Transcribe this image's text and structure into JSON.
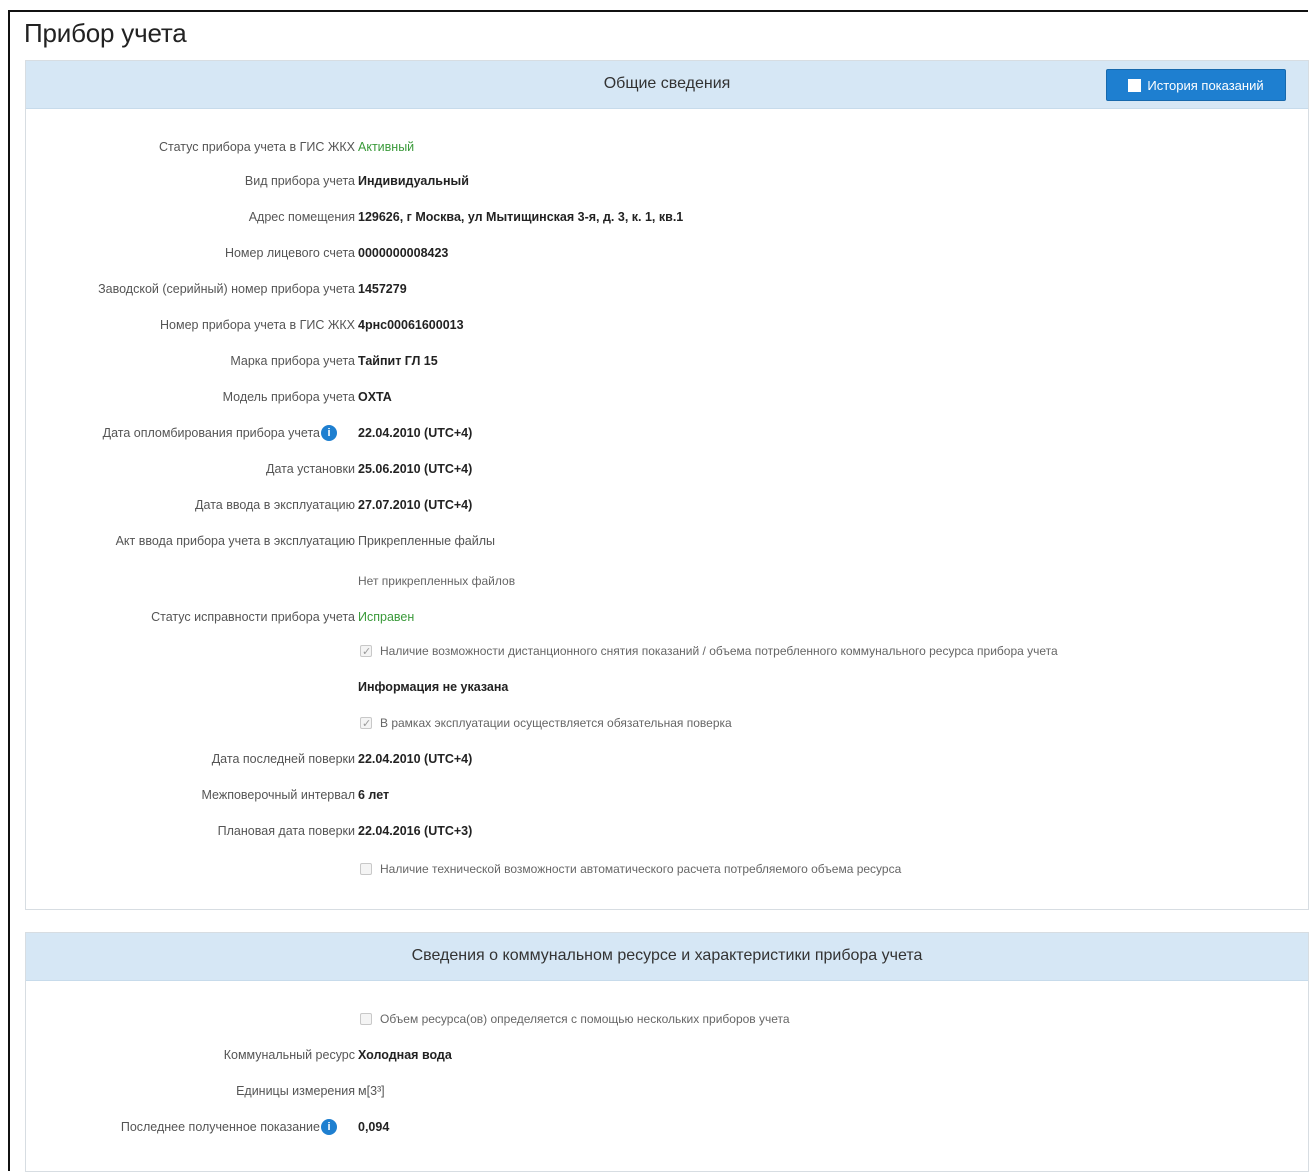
{
  "page": {
    "title": "Прибор учета"
  },
  "general": {
    "title": "Общие сведения",
    "history_button": "История показаний",
    "status_label": "Статус прибора учета в ГИС ЖКХ",
    "status_value": "Активный",
    "kind_label": "Вид прибора учета",
    "kind_value": "Индивидуальный",
    "address_label": "Адрес помещения",
    "address_value": "129626, г Москва, ул Мытищинская 3-я, д. 3, к. 1, кв.1",
    "account_label": "Номер лицевого счета",
    "account_value": "0000000008423",
    "serial_label": "Заводской (серийный) номер прибора учета",
    "serial_value": "1457279",
    "gis_number_label": "Номер прибора учета в ГИС ЖКХ",
    "gis_number_value": "4рнс00061600013",
    "brand_label": "Марка прибора учета",
    "brand_value": "Тайпит ГЛ 15",
    "model_label": "Модель прибора учета",
    "model_value": "OXTA",
    "sealing_date_label": "Дата опломбирования прибора учета",
    "sealing_date_value": "22.04.2010 (UTC+4)",
    "install_date_label": "Дата установки",
    "install_date_value": "25.06.2010 (UTC+4)",
    "commission_date_label": "Дата ввода в эксплуатацию",
    "commission_date_value": "27.07.2010 (UTC+4)",
    "commission_act_label": "Акт ввода прибора учета в эксплуатацию",
    "commission_act_value": "Прикрепленные файлы",
    "no_files_text": "Нет прикрепленных файлов",
    "health_label": "Статус исправности прибора учета",
    "health_value": "Исправен",
    "remote_reading_check": "Наличие возможности дистанционного снятия показаний / объема потребленного коммунального ресурса прибора учета",
    "info_not_specified": "Информация не указана",
    "mandatory_verification_check": "В рамках эксплуатации осуществляется обязательная поверка",
    "last_verification_label": "Дата последней поверки",
    "last_verification_value": "22.04.2010 (UTC+4)",
    "interval_label": "Межповерочный интервал",
    "interval_value": "6 лет",
    "planned_verification_label": "Плановая дата поверки",
    "planned_verification_value": "22.04.2016 (UTC+3)",
    "auto_calc_check": "Наличие технической возможности автоматического расчета потребляемого объема ресурса"
  },
  "resource": {
    "title": "Сведения о коммунальном ресурсе и характеристики прибора учета",
    "multi_device_check": "Объем ресурса(ов) определяется с помощью нескольких приборов учета",
    "resource_label": "Коммунальный ресурс",
    "resource_value": "Холодная вода",
    "unit_label": "Единицы измерения",
    "unit_value": "м[3³]",
    "last_reading_label": "Последнее полученное показание",
    "last_reading_value": "0,094"
  },
  "colors": {
    "header_bg": "#d6e7f5",
    "button": "#1e7fd0",
    "status_green": "#3a9a3a"
  },
  "icons": {
    "info": "info-circle-icon",
    "history": "table-icon"
  }
}
